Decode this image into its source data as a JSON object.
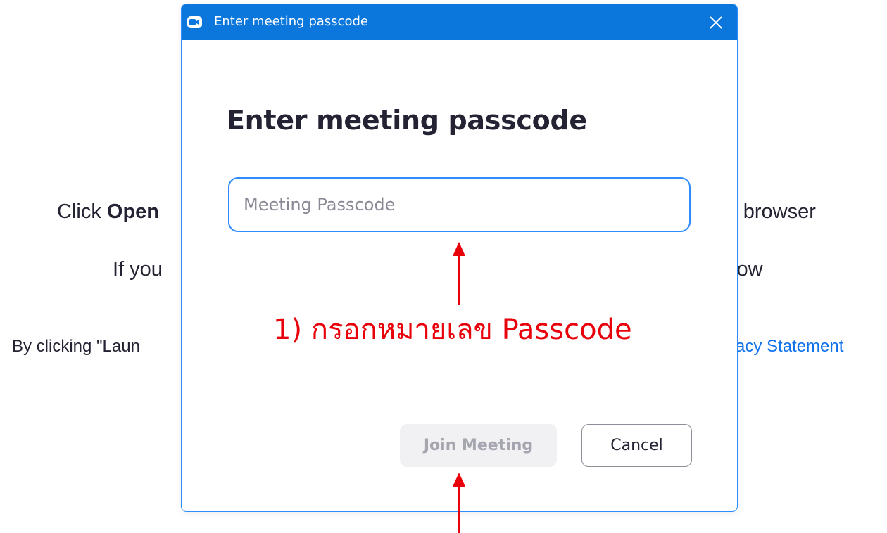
{
  "background": {
    "line1_prefix": "Click ",
    "line1_bold": "Open",
    "line1_suffix": "r browser",
    "line2_prefix": "If you",
    "line2_suffix": "low",
    "line3_prefix": "By clicking \"Laun",
    "line3_link": "acy Statement"
  },
  "dialog": {
    "window_title": "Enter meeting passcode",
    "heading": "Enter meeting passcode",
    "passcode_input": {
      "placeholder": "Meeting Passcode",
      "value": ""
    },
    "join_button_label": "Join Meeting",
    "cancel_button_label": "Cancel"
  },
  "annotation": {
    "step1_label": "1) กรอกหมายเลข Passcode",
    "color": "#e8000b"
  },
  "colors": {
    "titlebar": "#0b77dc",
    "accent": "#2d8cff",
    "link": "#0e72ed"
  },
  "icons": {
    "app": "zoom-camera-icon",
    "close": "close-icon"
  }
}
